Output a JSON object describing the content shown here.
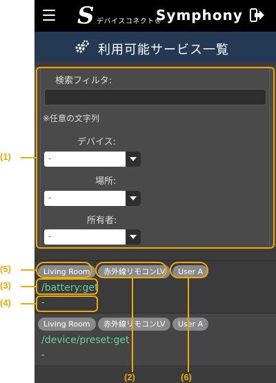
{
  "header": {
    "brand_mark": "S",
    "brand_jp": "デバイスコネクト®",
    "brand_en": "Symphony",
    "menu_icon": "hamburger-menu-icon",
    "logout_icon": "logout-icon"
  },
  "title_bar": {
    "icon": "gear-icon",
    "title": "利用可能サービス一覧"
  },
  "filter": {
    "search_label": "検索フィルタ:",
    "search_value": "",
    "hint": "※任意の文字列",
    "device_label": "デバイス:",
    "device_value": "-",
    "place_label": "場所:",
    "place_value": "-",
    "owner_label": "所有者:",
    "owner_value": "-"
  },
  "services": [
    {
      "tags": [
        "Living Room",
        "赤外線リモコンLV",
        "User A"
      ],
      "path": "/battery:get",
      "description": "-"
    },
    {
      "tags": [
        "Living Room",
        "赤外線リモコンLV",
        "User A"
      ],
      "path": "/device/preset:get",
      "description": "-"
    }
  ],
  "callouts": {
    "c1": "(1)",
    "c2": "(2)",
    "c3": "(3)",
    "c4": "(4)",
    "c5": "(5)",
    "c6": "(6)"
  },
  "colors": {
    "accent": "#f2a900",
    "path_text": "#5fd3a0",
    "title_bar": "#243a54"
  }
}
